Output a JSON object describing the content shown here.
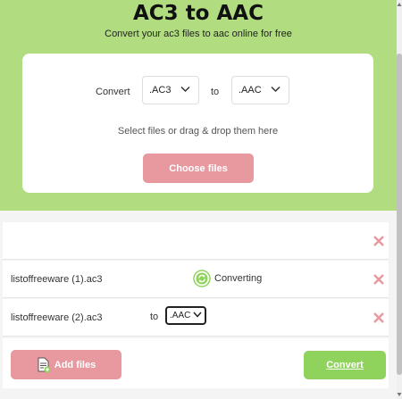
{
  "header": {
    "title": "AC3 to AAC",
    "subtitle": "Convert your ac3 files to aac online for free"
  },
  "converter": {
    "convert_label": "Convert",
    "from_format": ".AC3",
    "to_label": "to",
    "to_format": ".AAC",
    "hint": "Select files or drag & drop them here",
    "choose_button": "Choose files"
  },
  "files": [
    {
      "name": "listoffreeware (1).ac3",
      "status": "Converting"
    },
    {
      "name": "listoffreeware (2).ac3",
      "to_label": "to",
      "target_format": ".AAC"
    }
  ],
  "actions": {
    "add_files": "Add files",
    "convert": "Convert"
  },
  "colors": {
    "hero_bg": "#b1dd80",
    "pink_button": "#e8999f",
    "green_button": "#90d35c",
    "delete_icon": "#e8999f"
  },
  "icons": {
    "delete": "close-x-icon",
    "status": "refresh-icon",
    "add": "add-file-icon",
    "dropdown": "chevron-down-icon"
  }
}
